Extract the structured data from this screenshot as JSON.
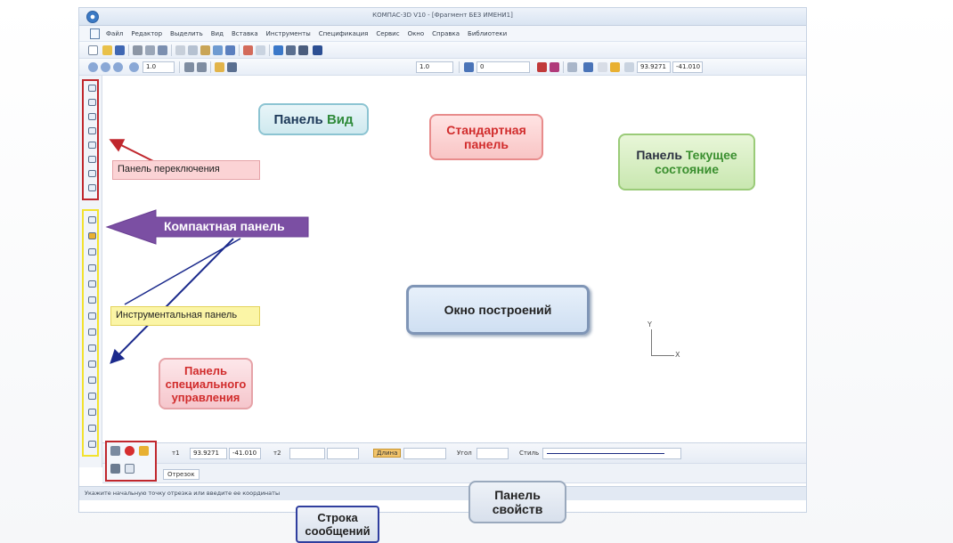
{
  "window": {
    "title": "КОМПАС-3D V10 - [Фрагмент БЕЗ ИМЕНИ1]"
  },
  "menu": {
    "items": [
      "Файл",
      "Редактор",
      "Выделить",
      "Вид",
      "Вставка",
      "Инструменты",
      "Спецификация",
      "Сервис",
      "Окно",
      "Справка",
      "Библиотеки"
    ]
  },
  "toolbar_view": {
    "zoom_value": "1.0"
  },
  "toolbar_state": {
    "step_value": "1.0",
    "layer_value": "0",
    "coord_x": "93.9271",
    "coord_y": "-41.010"
  },
  "properties": {
    "t1_label": "т1",
    "t1_x": "93.9271",
    "t1_y": "-41.010",
    "t2_label": "т2",
    "length_label": "Длина",
    "angle_label": "Угол",
    "style_label": "Стиль",
    "tab_label": "Отрезок"
  },
  "status": {
    "message": "Укажите начальную точку отрезка или введите ее координаты"
  },
  "axes": {
    "y_label": "Y",
    "x_label": "X"
  },
  "callouts": {
    "view_panel_prefix": "Панель",
    "view_panel_accent": "Вид",
    "standard_panel_line1": "Стандартная",
    "standard_panel_line2": "панель",
    "current_state_prefix": "Панель",
    "current_state_accent": "Текущее",
    "current_state_line2": "состояние",
    "switch_panel": "Панель переключения",
    "compact_panel": "Компактная панель",
    "tools_panel": "Инструментальная панель",
    "build_window": "Окно построений",
    "special_panel_line1": "Панель",
    "special_panel_line2": "специального",
    "special_panel_line3": "управления",
    "properties_panel_line1": "Панель",
    "properties_panel_line2": "свойств",
    "messages_line1": "Строка",
    "messages_line2": "сообщений"
  },
  "colors": {
    "accent_green": "#3a8f2f",
    "callout_red": "#d9373d",
    "callout_blue": "#2f3e9e",
    "arrow_purple": "#7b4fa3"
  }
}
